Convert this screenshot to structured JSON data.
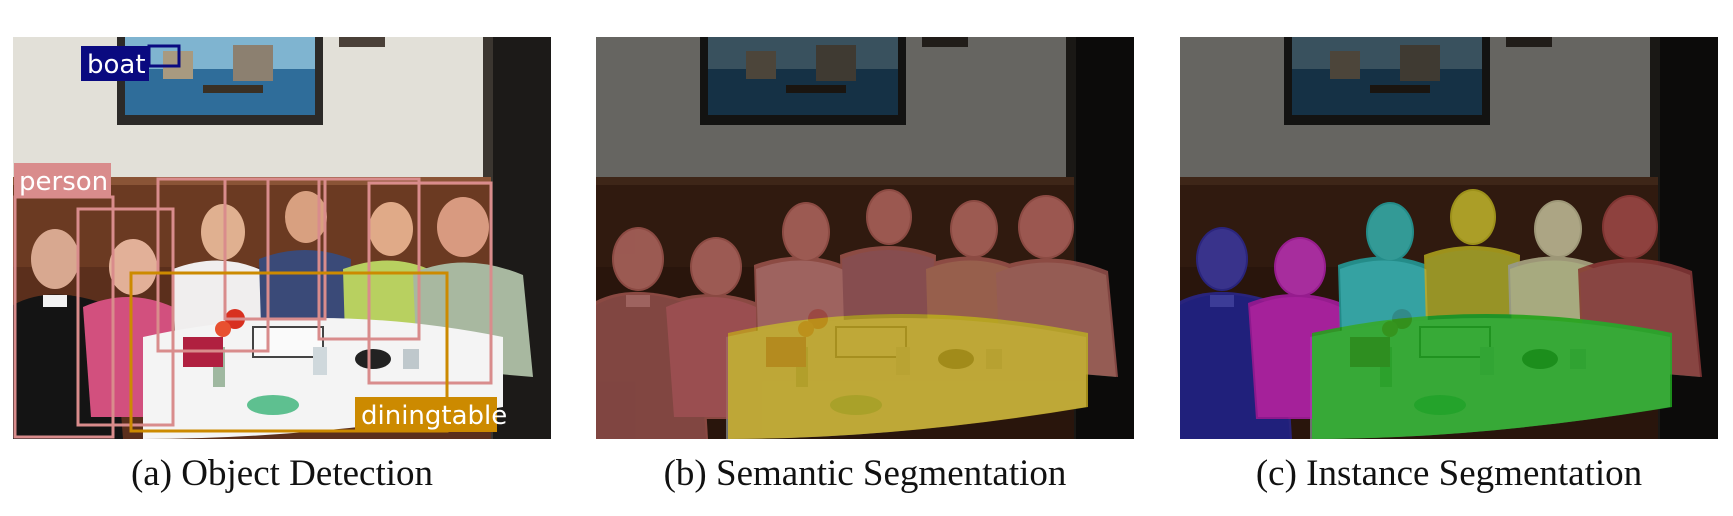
{
  "figure": {
    "panels": [
      {
        "caption": "(a) Object Detection",
        "labels": {
          "boat": "boat",
          "person": "person",
          "diningtable": "diningtable"
        }
      },
      {
        "caption": "(b) Semantic Segmentation"
      },
      {
        "caption": "(c) Instance Segmentation"
      }
    ],
    "colors": {
      "boat": "#0a0a80",
      "person": "#d98c8c",
      "diningtable": "#cc8a00",
      "semantic_person": "#b4605a",
      "semantic_table": "#e0c020",
      "instance_table": "#22c022",
      "instances": [
        "#2a2aa8",
        "#c020c0",
        "#20b8b8",
        "#c8c020",
        "#c8c8a0",
        "#a04040"
      ]
    }
  }
}
